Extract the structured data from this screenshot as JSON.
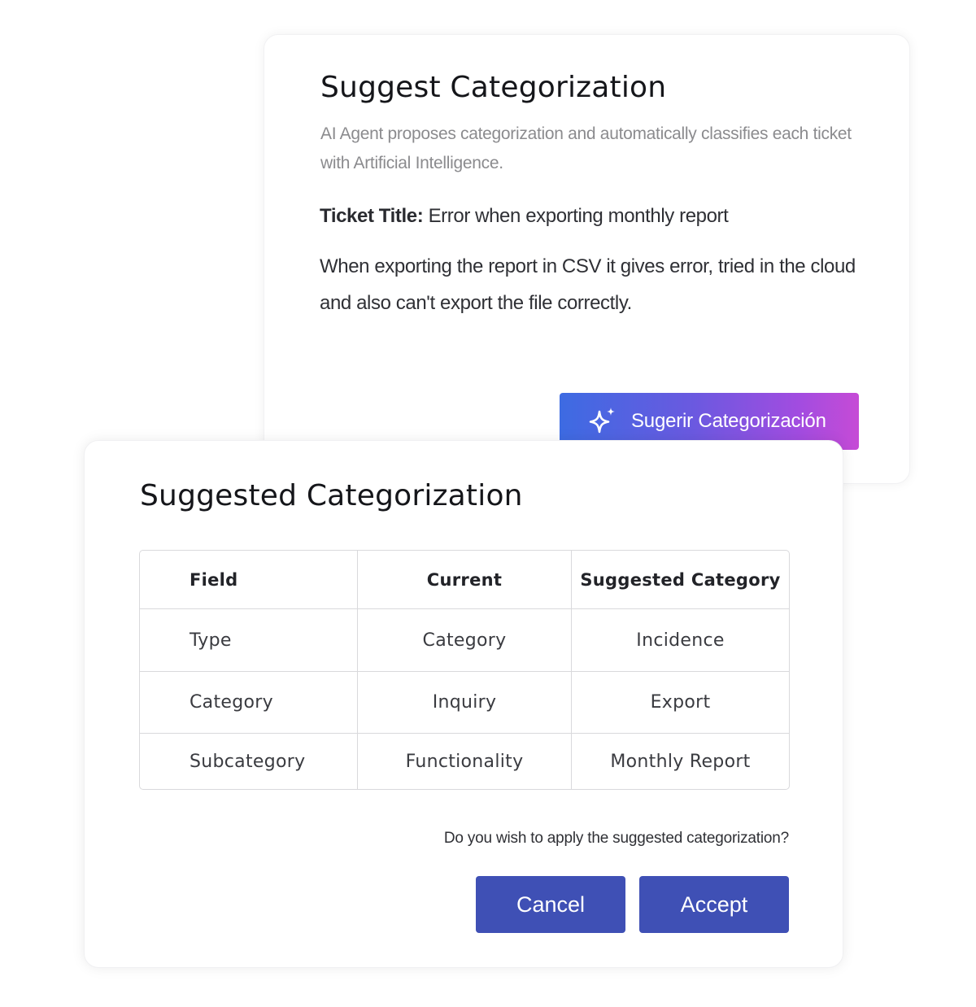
{
  "suggest_card": {
    "title": "Suggest Categorization",
    "subtitle": "AI Agent proposes categorization and automatically classifies each ticket with Artificial Intelligence.",
    "ticket_title_label": "Ticket Title:",
    "ticket_title_value": "Error when exporting monthly report",
    "ticket_description": "When exporting the report in CSV it gives error, tried in the cloud and also can't export the file correctly.",
    "button": {
      "label": "Sugerir Categorización",
      "icon": "sparkle-icon"
    }
  },
  "result_card": {
    "title": "Suggested Categorization",
    "table": {
      "headers": [
        "Field",
        "Current",
        "Suggested Category"
      ],
      "rows": [
        [
          "Type",
          "Category",
          "Incidence"
        ],
        [
          "Category",
          "Inquiry",
          "Export"
        ],
        [
          "Subcategory",
          "Functionality",
          "Monthly Report"
        ]
      ]
    },
    "question": "Do you wish to apply the suggested categorization?",
    "cancel_label": "Cancel",
    "accept_label": "Accept"
  },
  "colors": {
    "primary_button": "#3f50b5",
    "gradient_start": "#3d6be2",
    "gradient_end": "#c64bd6"
  }
}
